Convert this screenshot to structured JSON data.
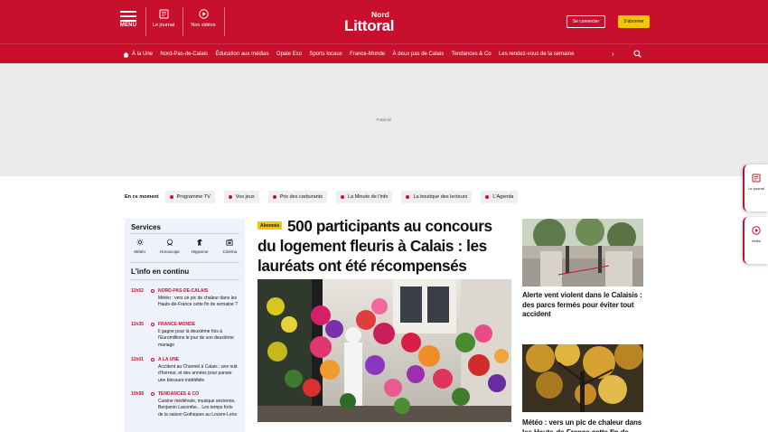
{
  "header": {
    "menu_label": "MENU",
    "journal_label": "Le journal",
    "videos_label": "Nos vidéos",
    "logo_top": "Nord",
    "logo_main": "Littoral",
    "login_label": "Se connecter",
    "subscribe_label": "S'abonner",
    "brand_color": "#c8102e",
    "subscribe_color": "#f6c600"
  },
  "nav": {
    "items": [
      "À la Une",
      "Nord-Pas-de-Calais",
      "Éducation aux médias",
      "Opale Eco",
      "Sports locaux",
      "France-Monde",
      "À deux pas de Calais",
      "Tendances & Co",
      "Les rendez-vous de la semaine"
    ],
    "more_icon": "chevron-right-icon",
    "search_icon": "search-icon"
  },
  "ad": {
    "label": "Publicité"
  },
  "moment": {
    "label": "En ce moment",
    "chips": [
      "Programme TV",
      "Vos jeux",
      "Prix des carburants",
      "La Minute de l'info",
      "La boutique des lecteurs",
      "L'Agenda"
    ]
  },
  "sidebar": {
    "services_title": "Services",
    "services": [
      {
        "label": "Météo",
        "icon": "sun-icon"
      },
      {
        "label": "Horoscope",
        "icon": "horoscope-icon"
      },
      {
        "label": "Hippisme",
        "icon": "horse-icon"
      },
      {
        "label": "Cinéma",
        "icon": "cinema-icon"
      }
    ],
    "live_title": "L'info en continu",
    "news": [
      {
        "time": "11h52",
        "category": "NORD-PAS-DE-CALAIS",
        "text": "Météo : vers un pic de chaleur dans les Hauts-de-France cette fin de semaine ?"
      },
      {
        "time": "11h35",
        "category": "FRANCE-MONDE",
        "text": "Il gagne pour la deuxième fois à l'Euromillions le jour de son deuxième mariage"
      },
      {
        "time": "11h01",
        "category": "A LA UNE",
        "text": "Accident au Channel à Calais : une nuit d'horreur, et des années pour panser une blessure indélébile"
      },
      {
        "time": "10h56",
        "category": "TENDANCES & CO",
        "text": "Cuisine médiévale, musique ancienne, Benjamin Lacombe... Les temps forts de la saison Gothiques au Louvre-Lens"
      }
    ]
  },
  "main_article": {
    "badge": "Abonnés",
    "title": "500 participants au concours du logement fleuris à Calais : les lauréats ont été récompensés"
  },
  "right_column": {
    "cards": [
      {
        "title": "Alerte vent violent dans le Calaisis : des parcs fermés pour éviter tout accident"
      },
      {
        "title": "Météo : vers un pic de chaleur dans les Hauts-de-France cette fin de"
      }
    ]
  },
  "floating": {
    "journal_label": "Le journal",
    "video_label": "Vidéo"
  }
}
